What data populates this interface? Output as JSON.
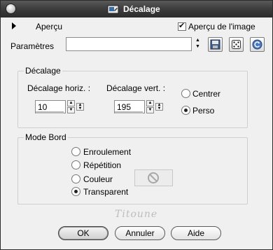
{
  "window": {
    "title": "Décalage"
  },
  "preview": {
    "section_label": "Aperçu",
    "checkbox_label": "Aperçu de l'image",
    "checked": true
  },
  "presets": {
    "label": "Paramètres",
    "value": ""
  },
  "offset_group": {
    "title": "Décalage",
    "horiz_label": "Décalage horiz. :",
    "horiz_value": "10",
    "vert_label": "Décalage vert. :",
    "vert_value": "195",
    "options": [
      {
        "label": "Centrer",
        "selected": false
      },
      {
        "label": "Perso",
        "selected": true
      }
    ]
  },
  "edge_group": {
    "title": "Mode Bord",
    "options": [
      {
        "label": "Enroulement",
        "selected": false
      },
      {
        "label": "Répétition",
        "selected": false
      },
      {
        "label": "Couleur",
        "selected": false
      },
      {
        "label": "Transparent",
        "selected": true
      }
    ]
  },
  "signature": "Titoune",
  "buttons": {
    "ok": "OK",
    "cancel": "Annuler",
    "help": "Aide"
  },
  "icons": {
    "save": "save-icon",
    "randomize": "dice-icon",
    "reset": "reset-icon",
    "no_color": "no-color-icon"
  }
}
